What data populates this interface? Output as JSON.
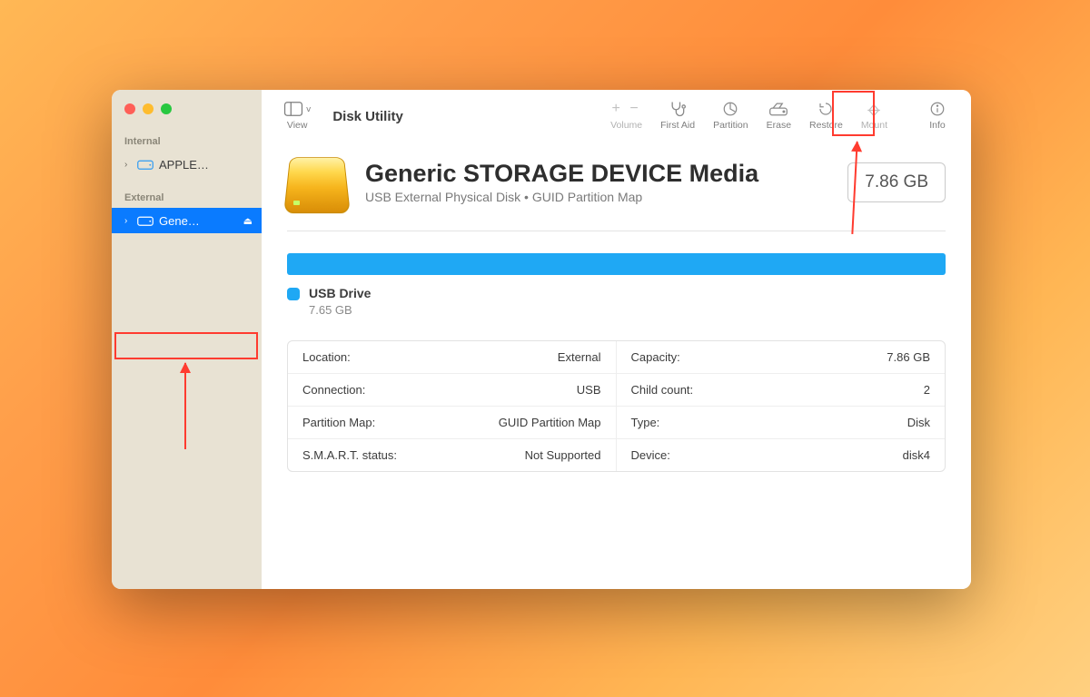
{
  "window": {
    "title": "Disk Utility"
  },
  "toolbar": {
    "view": "View",
    "volume": "Volume",
    "first_aid": "First Aid",
    "partition": "Partition",
    "erase": "Erase",
    "restore": "Restore",
    "mount": "Mount",
    "info": "Info"
  },
  "sidebar": {
    "internal_label": "Internal",
    "external_label": "External",
    "internal": [
      {
        "label": "APPLE…"
      }
    ],
    "external": [
      {
        "label": "Gene…",
        "selected": true,
        "ejectable": true
      }
    ]
  },
  "disk": {
    "title": "Generic STORAGE DEVICE Media",
    "subtitle": "USB External Physical Disk • GUID Partition Map",
    "capacity_badge": "7.86 GB"
  },
  "volume": {
    "name": "USB Drive",
    "size": "7.65 GB"
  },
  "info": {
    "left": [
      {
        "key": "Location:",
        "value": "External"
      },
      {
        "key": "Connection:",
        "value": "USB"
      },
      {
        "key": "Partition Map:",
        "value": "GUID Partition Map"
      },
      {
        "key": "S.M.A.R.T. status:",
        "value": "Not Supported"
      }
    ],
    "right": [
      {
        "key": "Capacity:",
        "value": "7.86 GB"
      },
      {
        "key": "Child count:",
        "value": "2"
      },
      {
        "key": "Type:",
        "value": "Disk"
      },
      {
        "key": "Device:",
        "value": "disk4"
      }
    ]
  },
  "annotations": {
    "highlighted_toolbar_button": "erase",
    "highlighted_sidebar_item": "external.0"
  }
}
